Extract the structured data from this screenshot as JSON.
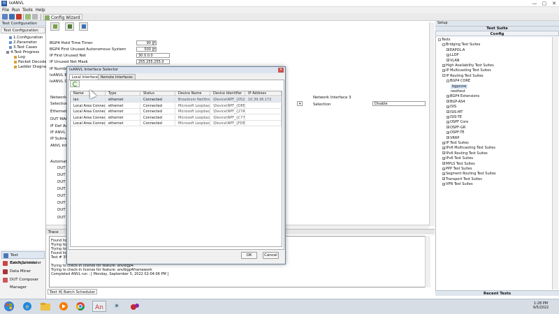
{
  "window": {
    "title": "IxANVL",
    "minimize": "—",
    "maximize": "▢",
    "close": "✕"
  },
  "menu": [
    "File",
    "Run",
    "Tools",
    "Help"
  ],
  "toolbar": {
    "config_wizard": "Config Wizard"
  },
  "left_panel": {
    "header": "Test Configuration",
    "tab": "Test Configuration",
    "tree": [
      "1.Configuration",
      "2.Parameter",
      "3.Test Cases",
      "4.Test Progress",
      "Log",
      "Packet Decode",
      "Ladder Diagram"
    ]
  },
  "left_nav": [
    "Test Configuration",
    "Batch Scheduler",
    "Data Miner",
    "DUT Composer Manager"
  ],
  "form": {
    "hold_timer_label": "BGP4 Hold Time Timer",
    "hold_timer_value": "90",
    "asn_label": "BGP4 First Unused Autonomous System",
    "asn_value": "500",
    "ip_unused_net_label": "IP First Unused Net",
    "ip_unused_net_value": "30.0.0.0",
    "ip_unused_mask_label": "IP Unused Net Mask",
    "ip_unused_mask_value": "255.255.255.0",
    "ip_number_label": "IP Number",
    "ixanvl_en_label": "IxANVL Ena",
    "ixanvl_do_label": "IxANVL Do",
    "network_label": "Network I",
    "selection_label": "Selection",
    "ethernet_label": "Ethernet 3",
    "dut_mac_label": "DUT MAC A",
    "if_def_label": "IF Def Addr",
    "ip_anvl_label": "IP ANVL A",
    "ip_subnet_label": "IP Subnet M",
    "anvl_inter_label": "ANVL Inter",
    "network3_label": "Network Interface 3",
    "selection3_label": "Selection",
    "selection3_value": "Disable",
    "automation_label": "Automatio",
    "dut_fields": [
      "DUT Userna",
      "DUT Passw",
      "DUT Passw",
      "DUT Promp",
      "DUT Custon",
      "DUT Custon",
      "DUT Hostn",
      "DUT Interf"
    ]
  },
  "trace": {
    "header": "Trace",
    "lines": [
      "Found lice",
      "Trying to c",
      "Trying to c",
      "Found lice",
      "Test # 35",
      "Trying to check-in license for feature: anvlbgp4",
      "Trying to check-in license for feature: anvlbgp4framework",
      "Completed ANVL run : [ Monday, September 5, 2022 02:04:06 PM ]"
    ],
    "tabs": [
      "Test 48",
      "Batch Scheduler"
    ]
  },
  "right_panel": {
    "setup": "Setup",
    "suite_header": "Test Suite",
    "config_header": "Config",
    "recent_header": "Recent Tests",
    "tree": [
      {
        "label": "Tests",
        "level": 0,
        "exp": "-"
      },
      {
        "label": "Bridging Test Suites",
        "level": 1,
        "exp": "-"
      },
      {
        "label": "EAPOL-A",
        "level": 2,
        "exp": "+"
      },
      {
        "label": "LLDP",
        "level": 2,
        "exp": "+"
      },
      {
        "label": "VLAN",
        "level": 2,
        "exp": "+"
      },
      {
        "label": "High Availability Test Suites",
        "level": 1,
        "exp": "+"
      },
      {
        "label": "IP Multicasting Test Suites",
        "level": 1,
        "exp": "+"
      },
      {
        "label": "IP Routing Test Suites",
        "level": 1,
        "exp": "-"
      },
      {
        "label": "BGP4 CORE",
        "level": 2,
        "exp": "-"
      },
      {
        "label": "bgpcore",
        "level": 3,
        "exp": "",
        "selected": true
      },
      {
        "label": "nexttest",
        "level": 3,
        "exp": ""
      },
      {
        "label": "BGP4 Extensions",
        "level": 2,
        "exp": "+"
      },
      {
        "label": "BGP-AS4",
        "level": 2,
        "exp": "+"
      },
      {
        "label": "ISIS",
        "level": 2,
        "exp": "+"
      },
      {
        "label": "ISIS-MT",
        "level": 2,
        "exp": "+"
      },
      {
        "label": "ISIS-TE",
        "level": 2,
        "exp": "+"
      },
      {
        "label": "OSPF Core",
        "level": 2,
        "exp": "+"
      },
      {
        "label": "OSPF-GR",
        "level": 2,
        "exp": "+"
      },
      {
        "label": "OSPF-TE",
        "level": 2,
        "exp": "+"
      },
      {
        "label": "VRRP",
        "level": 2,
        "exp": "+"
      },
      {
        "label": "IP Test Suites",
        "level": 1,
        "exp": "+"
      },
      {
        "label": "IPv6 Multicasting Test Suites",
        "level": 1,
        "exp": "+"
      },
      {
        "label": "IPv6 Routing Test Suites",
        "level": 1,
        "exp": "+"
      },
      {
        "label": "IPv6 Test Suites",
        "level": 1,
        "exp": "+"
      },
      {
        "label": "MPLS Test Suites",
        "level": 1,
        "exp": "+"
      },
      {
        "label": "PPP Test Suites",
        "level": 1,
        "exp": "+"
      },
      {
        "label": "Segment Routing Test Suites",
        "level": 1,
        "exp": "+"
      },
      {
        "label": "Transport Test Suites",
        "level": 1,
        "exp": "+"
      },
      {
        "label": "VPN Test Suites",
        "level": 1,
        "exp": "+"
      }
    ]
  },
  "dialog": {
    "title": "IxANVL Interface Selector",
    "tabs": [
      "Local Interfaces",
      "Remote Interfaces"
    ],
    "columns": [
      "Name",
      "Type",
      "Status",
      "Device Name",
      "Device Identifier",
      "IP Address"
    ],
    "rows": [
      [
        "lan",
        "ethernet",
        "Connected",
        "Broadcom NetXtreme...",
        "\\Device\\NPF_{0521...",
        "10.39.36.172"
      ],
      [
        "Local Area Connectio...",
        "ethernet",
        "Connected",
        "Microsoft Loopback A...",
        "\\Device\\NPF_{DEBCF...",
        ""
      ],
      [
        "Local Area Connectio...",
        "ethernet",
        "Connected",
        "Microsoft Loopback A...",
        "\\Device\\NPF_{27A35...",
        ""
      ],
      [
        "Local Area Connectio...",
        "ethernet",
        "Connected",
        "Microsoft Loopback A...",
        "\\Device\\NPF_{C774E...",
        ""
      ],
      [
        "Local Area Connectio...",
        "ethernet",
        "Connected",
        "Microsoft Loopback A...",
        "\\Device\\NPF_{FDEE4...",
        ""
      ]
    ],
    "ok": "OK",
    "cancel": "Cancel"
  },
  "taskbar": {
    "time": "1:28 PM",
    "date": "9/5/2022"
  }
}
